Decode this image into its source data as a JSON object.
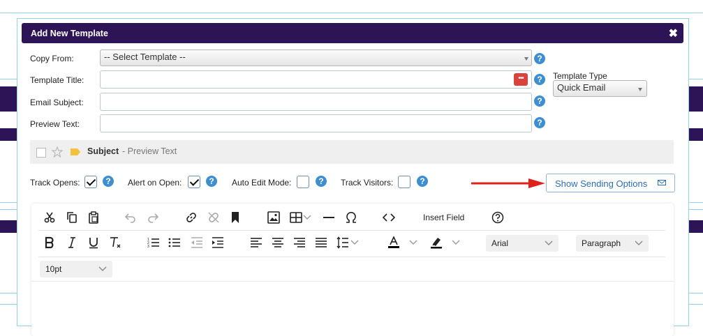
{
  "modal": {
    "title": "Add New Template",
    "close": "✖"
  },
  "form": {
    "copy_from_label": "Copy From:",
    "copy_from_value": "-- Select Template --",
    "template_title_label": "Template Title:",
    "template_title_value": "",
    "email_subject_label": "Email Subject:",
    "email_subject_value": "",
    "preview_text_label": "Preview Text:",
    "preview_text_value": "",
    "template_type_label": "Template Type",
    "template_type_value": "Quick Email",
    "dots_icon": "•••"
  },
  "preview": {
    "subject": "Subject",
    "preview_text": "- Preview Text"
  },
  "tracking": {
    "track_opens_label": "Track Opens:",
    "track_opens_checked": true,
    "alert_on_open_label": "Alert on Open:",
    "alert_on_open_checked": true,
    "auto_edit_mode_label": "Auto Edit Mode:",
    "auto_edit_mode_checked": false,
    "track_visitors_label": "Track Visitors:",
    "track_visitors_checked": false
  },
  "sending_options_button": "Show Sending Options",
  "editor": {
    "insert_field": "Insert Field",
    "font_family": "Arial",
    "block_format": "Paragraph",
    "font_size": "10pt"
  },
  "help": "?",
  "colors": {
    "header": "#2d1457",
    "help": "#3d8fd1",
    "arrow": "#e0201b",
    "link": "#2a6fb5"
  }
}
